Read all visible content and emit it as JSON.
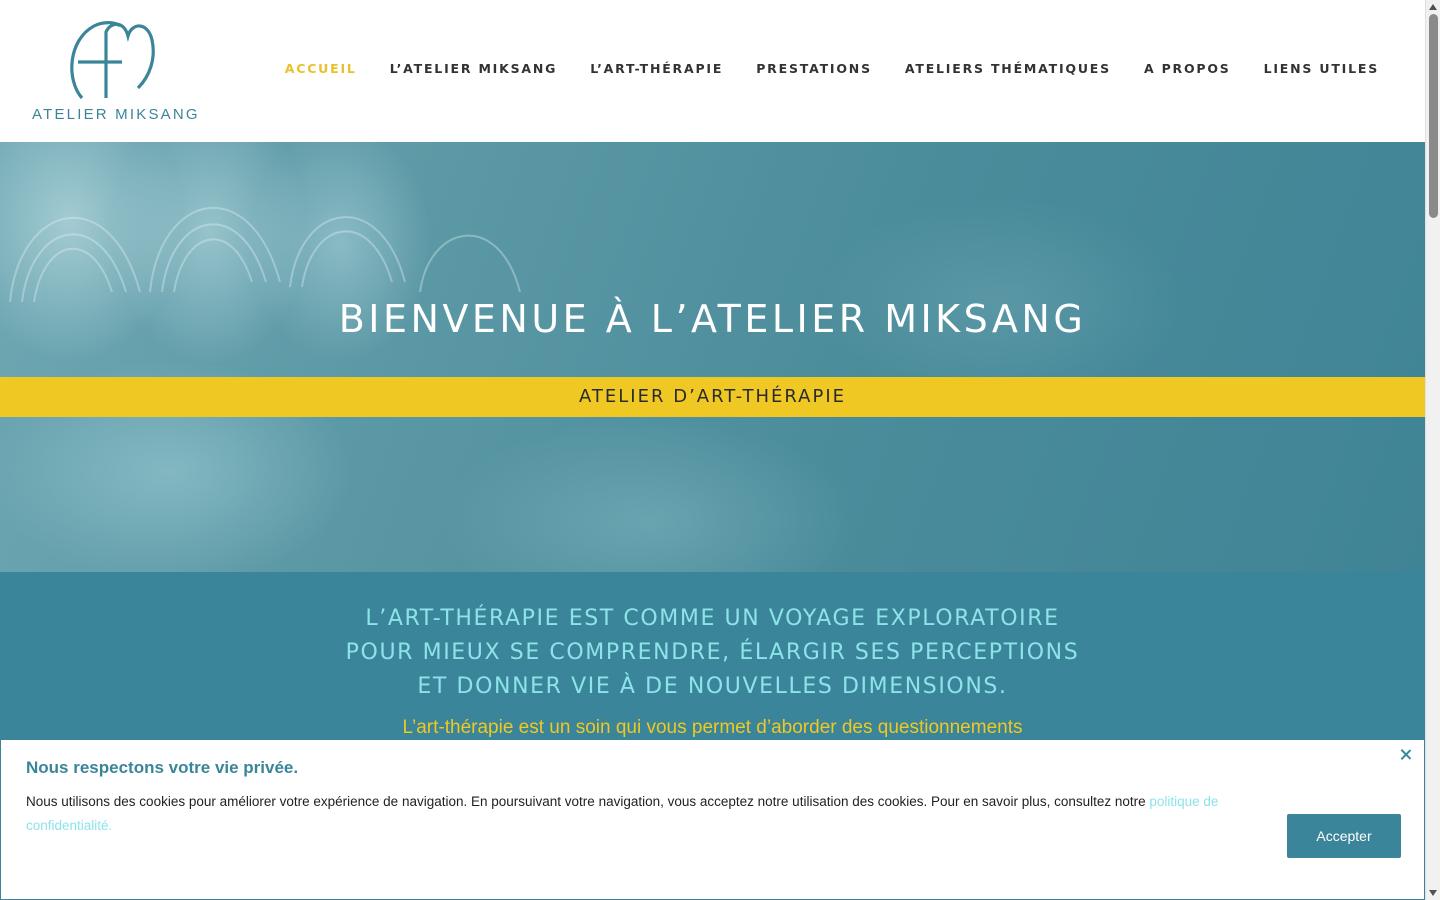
{
  "header": {
    "logo_text": "ATELIER MIKSANG",
    "nav": [
      {
        "label": "ACCUEIL",
        "active": true
      },
      {
        "label": "L’ATELIER MIKSANG",
        "active": false
      },
      {
        "label": "L’ART-THÉRAPIE",
        "active": false
      },
      {
        "label": "PRESTATIONS",
        "active": false
      },
      {
        "label": "ATELIERS THÉMATIQUES",
        "active": false
      },
      {
        "label": "A PROPOS",
        "active": false
      },
      {
        "label": "LIENS UTILES",
        "active": false
      }
    ]
  },
  "hero": {
    "title": "BIENVENUE À L’ATELIER MIKSANG",
    "subtitle": "ATELIER D’ART-THÉRAPIE"
  },
  "intro": {
    "lines": [
      "L’ART-THÉRAPIE EST COMME UN VOYAGE EXPLORATOIRE",
      "POUR MIEUX SE COMPRENDRE, ÉLARGIR SES PERCEPTIONS",
      "ET DONNER VIE À DE NOUVELLES DIMENSIONS."
    ],
    "text": "L’art-thérapie est un soin qui vous permet d’aborder des questionnements"
  },
  "cookie": {
    "title": "Nous respectons votre vie privée.",
    "text": "Nous utilisons des cookies pour améliorer votre expérience de navigation. En poursuivant votre navigation, vous acceptez notre utilisation des cookies. Pour en savoir plus, consultez notre ",
    "link": "politique de confidentialité.",
    "accept_label": "Accepter"
  },
  "colors": {
    "brand_teal": "#3a8599",
    "accent_yellow": "#f0c823",
    "light_cyan": "#8de3ea"
  },
  "icons": {
    "logo": "am-monogram-logo",
    "close": "close-icon"
  }
}
